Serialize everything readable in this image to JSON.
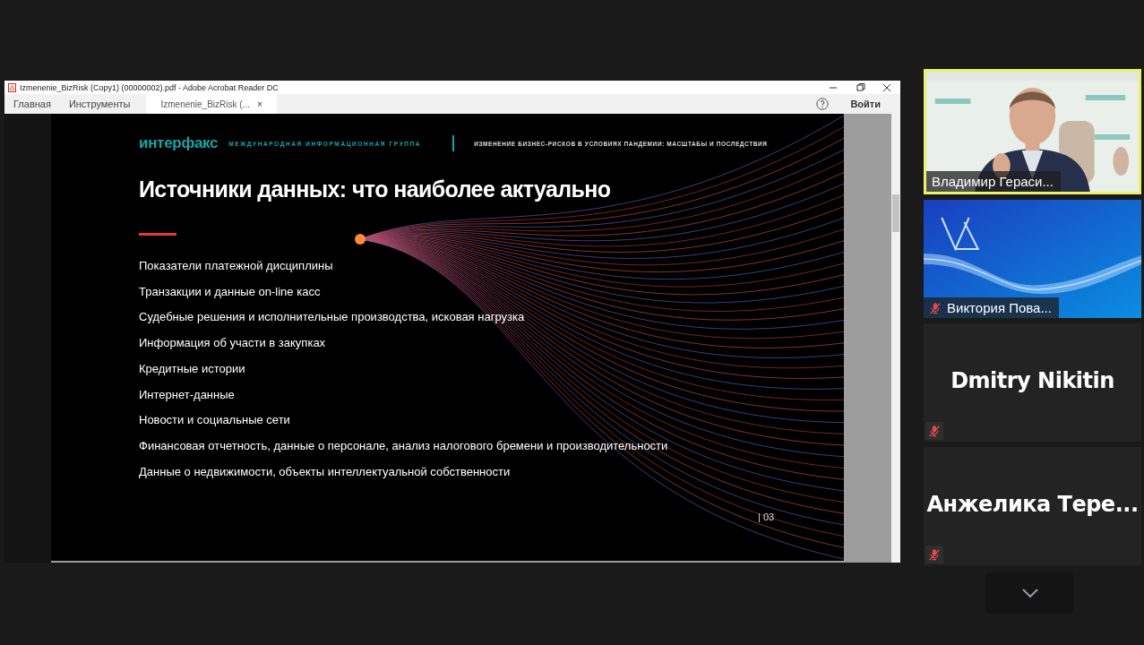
{
  "window": {
    "title": "Izmenenie_BizRisk (Copy1) (00000002).pdf - Adobe Acrobat Reader DC"
  },
  "tabs": [
    {
      "label": "Главная",
      "selected": false,
      "kind": "nav"
    },
    {
      "label": "Инструменты",
      "selected": false,
      "kind": "nav"
    },
    {
      "label": "Izmenenie_BizRisk (...",
      "selected": true,
      "kind": "document",
      "close": "×"
    }
  ],
  "sign_in": "Войти",
  "slide": {
    "logo": "интерфакс",
    "tagline": "МЕЖДУНАРОДНАЯ ИНФОРМАЦИОННАЯ ГРУППА",
    "header": "ИЗМЕНЕНИЕ БИЗНЕС-РИСКОВ В УСЛОВИЯХ ПАНДЕМИИ: МАСШТАБЫ И ПОСЛЕДСТВИЯ",
    "title": "Источники данных: что наиболее актуально",
    "items": [
      "Показатели платежной дисциплины",
      "Транзакции и данные on-line касс",
      "Судебные решения и исполнительные производства, исковая нагрузка",
      "Информация об участи в закупках",
      "Кредитные истории",
      "Интернет-данные",
      "Новости и социальные сети",
      "Финансовая отчетность, данные о персонале, анализ налогового бремени и производительности",
      "Данные о недвижимости, объекты интеллектуальной собственности"
    ],
    "page": "| 03"
  },
  "participants": [
    {
      "name": "Владимир Гераси...",
      "kind": "video",
      "active": true,
      "muted": false
    },
    {
      "name": "Виктория Пова...",
      "kind": "banner",
      "active": false,
      "muted": true
    },
    {
      "name": "Dmitry Nikitin",
      "kind": "avatar",
      "active": false,
      "muted": true
    },
    {
      "name": "Анжелика  Тере...",
      "kind": "avatar",
      "active": false,
      "muted": true
    }
  ]
}
